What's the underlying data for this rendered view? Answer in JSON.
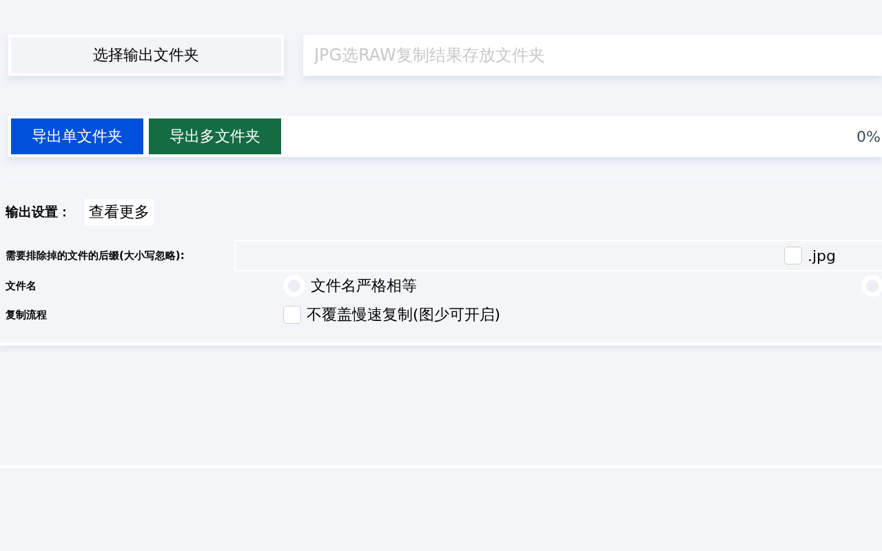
{
  "output_folder": {
    "button": "选择输出文件夹",
    "placeholder": "JPG选RAW复制结果存放文件夹"
  },
  "export": {
    "buttons": [
      {
        "label": "导出单文件夹",
        "kind": "primary"
      },
      {
        "label": "导出多文件夹",
        "kind": "success"
      }
    ],
    "progress": {
      "reading": "0%"
    }
  },
  "settings": {
    "title": "输出设置：",
    "more_button": "查看更多",
    "exclude_suffix": {
      "label": "需要排除掉的文件的后缀(大小写忽略):",
      "options": [
        {
          "label": ".jpg",
          "checked": false
        }
      ]
    },
    "file_name": {
      "label": "文件名",
      "options": [
        {
          "label": "文件名严格相等",
          "selected": false
        },
        {
          "selected": false
        }
      ]
    },
    "copy_flow": {
      "label": "复制流程",
      "options": [
        {
          "label": "不覆盖慢速复制(图少可开启)",
          "checked": false
        }
      ]
    }
  }
}
